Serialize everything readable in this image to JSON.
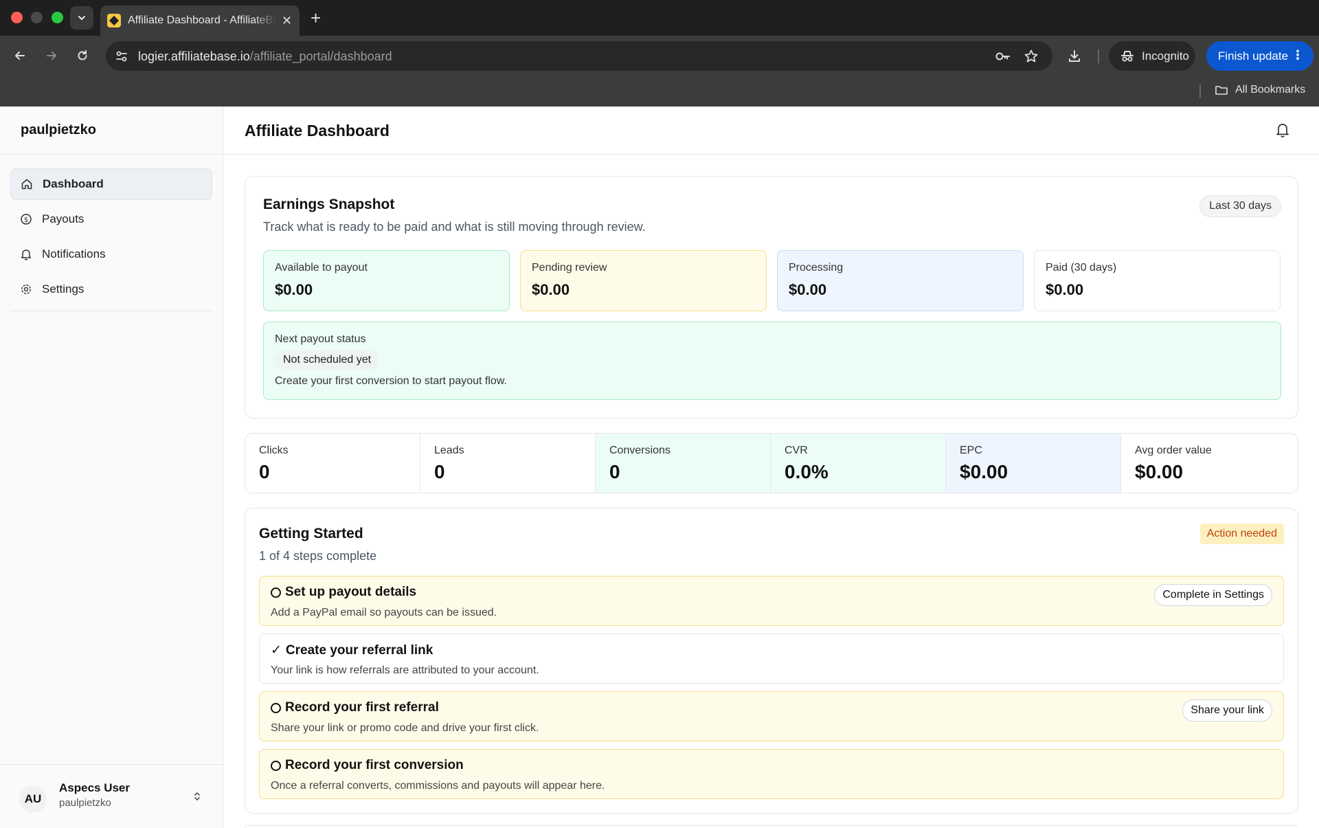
{
  "browser": {
    "tab_title": "Affiliate Dashboard - AffiliateBase",
    "url_host": "logier.affiliatebase.io",
    "url_path": "/affiliate_portal/dashboard",
    "incognito_label": "Incognito",
    "finish_update_label": "Finish update",
    "bookmarks_label": "All Bookmarks",
    "colors": {
      "update_button": "#0b57d0",
      "chrome_dark": "#1f1f1f",
      "chrome_toolbar": "#3c3c3c"
    }
  },
  "sidebar": {
    "brand": "paulpietzko",
    "items": [
      {
        "label": "Dashboard",
        "icon": "home-icon",
        "active": true
      },
      {
        "label": "Payouts",
        "icon": "dollar-circle-icon",
        "active": false
      },
      {
        "label": "Notifications",
        "icon": "bell-icon",
        "active": false
      },
      {
        "label": "Settings",
        "icon": "gear-icon",
        "active": false
      }
    ],
    "user": {
      "initials": "AU",
      "name": "Aspecs User",
      "handle": "paulpietzko"
    }
  },
  "header": {
    "title": "Affiliate Dashboard"
  },
  "snapshot": {
    "title": "Earnings Snapshot",
    "subtitle": "Track what is ready to be paid and what is still moving through review.",
    "range": "Last 30 days",
    "tiles": [
      {
        "label": "Available to payout",
        "value": "$0.00",
        "tone": "green"
      },
      {
        "label": "Pending review",
        "value": "$0.00",
        "tone": "yellow"
      },
      {
        "label": "Processing",
        "value": "$0.00",
        "tone": "blue"
      },
      {
        "label": "Paid (30 days)",
        "value": "$0.00",
        "tone": "white"
      }
    ],
    "next_payout": {
      "label": "Next payout status",
      "status": "Not scheduled yet",
      "description": "Create your first conversion to start payout flow."
    }
  },
  "stats": [
    {
      "label": "Clicks",
      "value": "0"
    },
    {
      "label": "Leads",
      "value": "0"
    },
    {
      "label": "Conversions",
      "value": "0"
    },
    {
      "label": "CVR",
      "value": "0.0%"
    },
    {
      "label": "EPC",
      "value": "$0.00"
    },
    {
      "label": "Avg order value",
      "value": "$0.00"
    }
  ],
  "getting_started": {
    "title": "Getting Started",
    "progress": "1 of 4 steps complete",
    "badge": "Action needed",
    "colors": {
      "badge_text": "#c2410c",
      "badge_bg": "#fdf0c0",
      "todo_bg": "#fefce8"
    },
    "steps": [
      {
        "title": "Set up payout details",
        "description": "Add a PayPal email so payouts can be issued.",
        "done": false,
        "action": "Complete in Settings"
      },
      {
        "title": "Create your referral link",
        "description": "Your link is how referrals are attributed to your account.",
        "done": true,
        "action": ""
      },
      {
        "title": "Record your first referral",
        "description": "Share your link or promo code and drive your first click.",
        "done": false,
        "action": "Share your link"
      },
      {
        "title": "Record your first conversion",
        "description": "Once a referral converts, commissions and payouts will appear here.",
        "done": false,
        "action": ""
      }
    ]
  }
}
